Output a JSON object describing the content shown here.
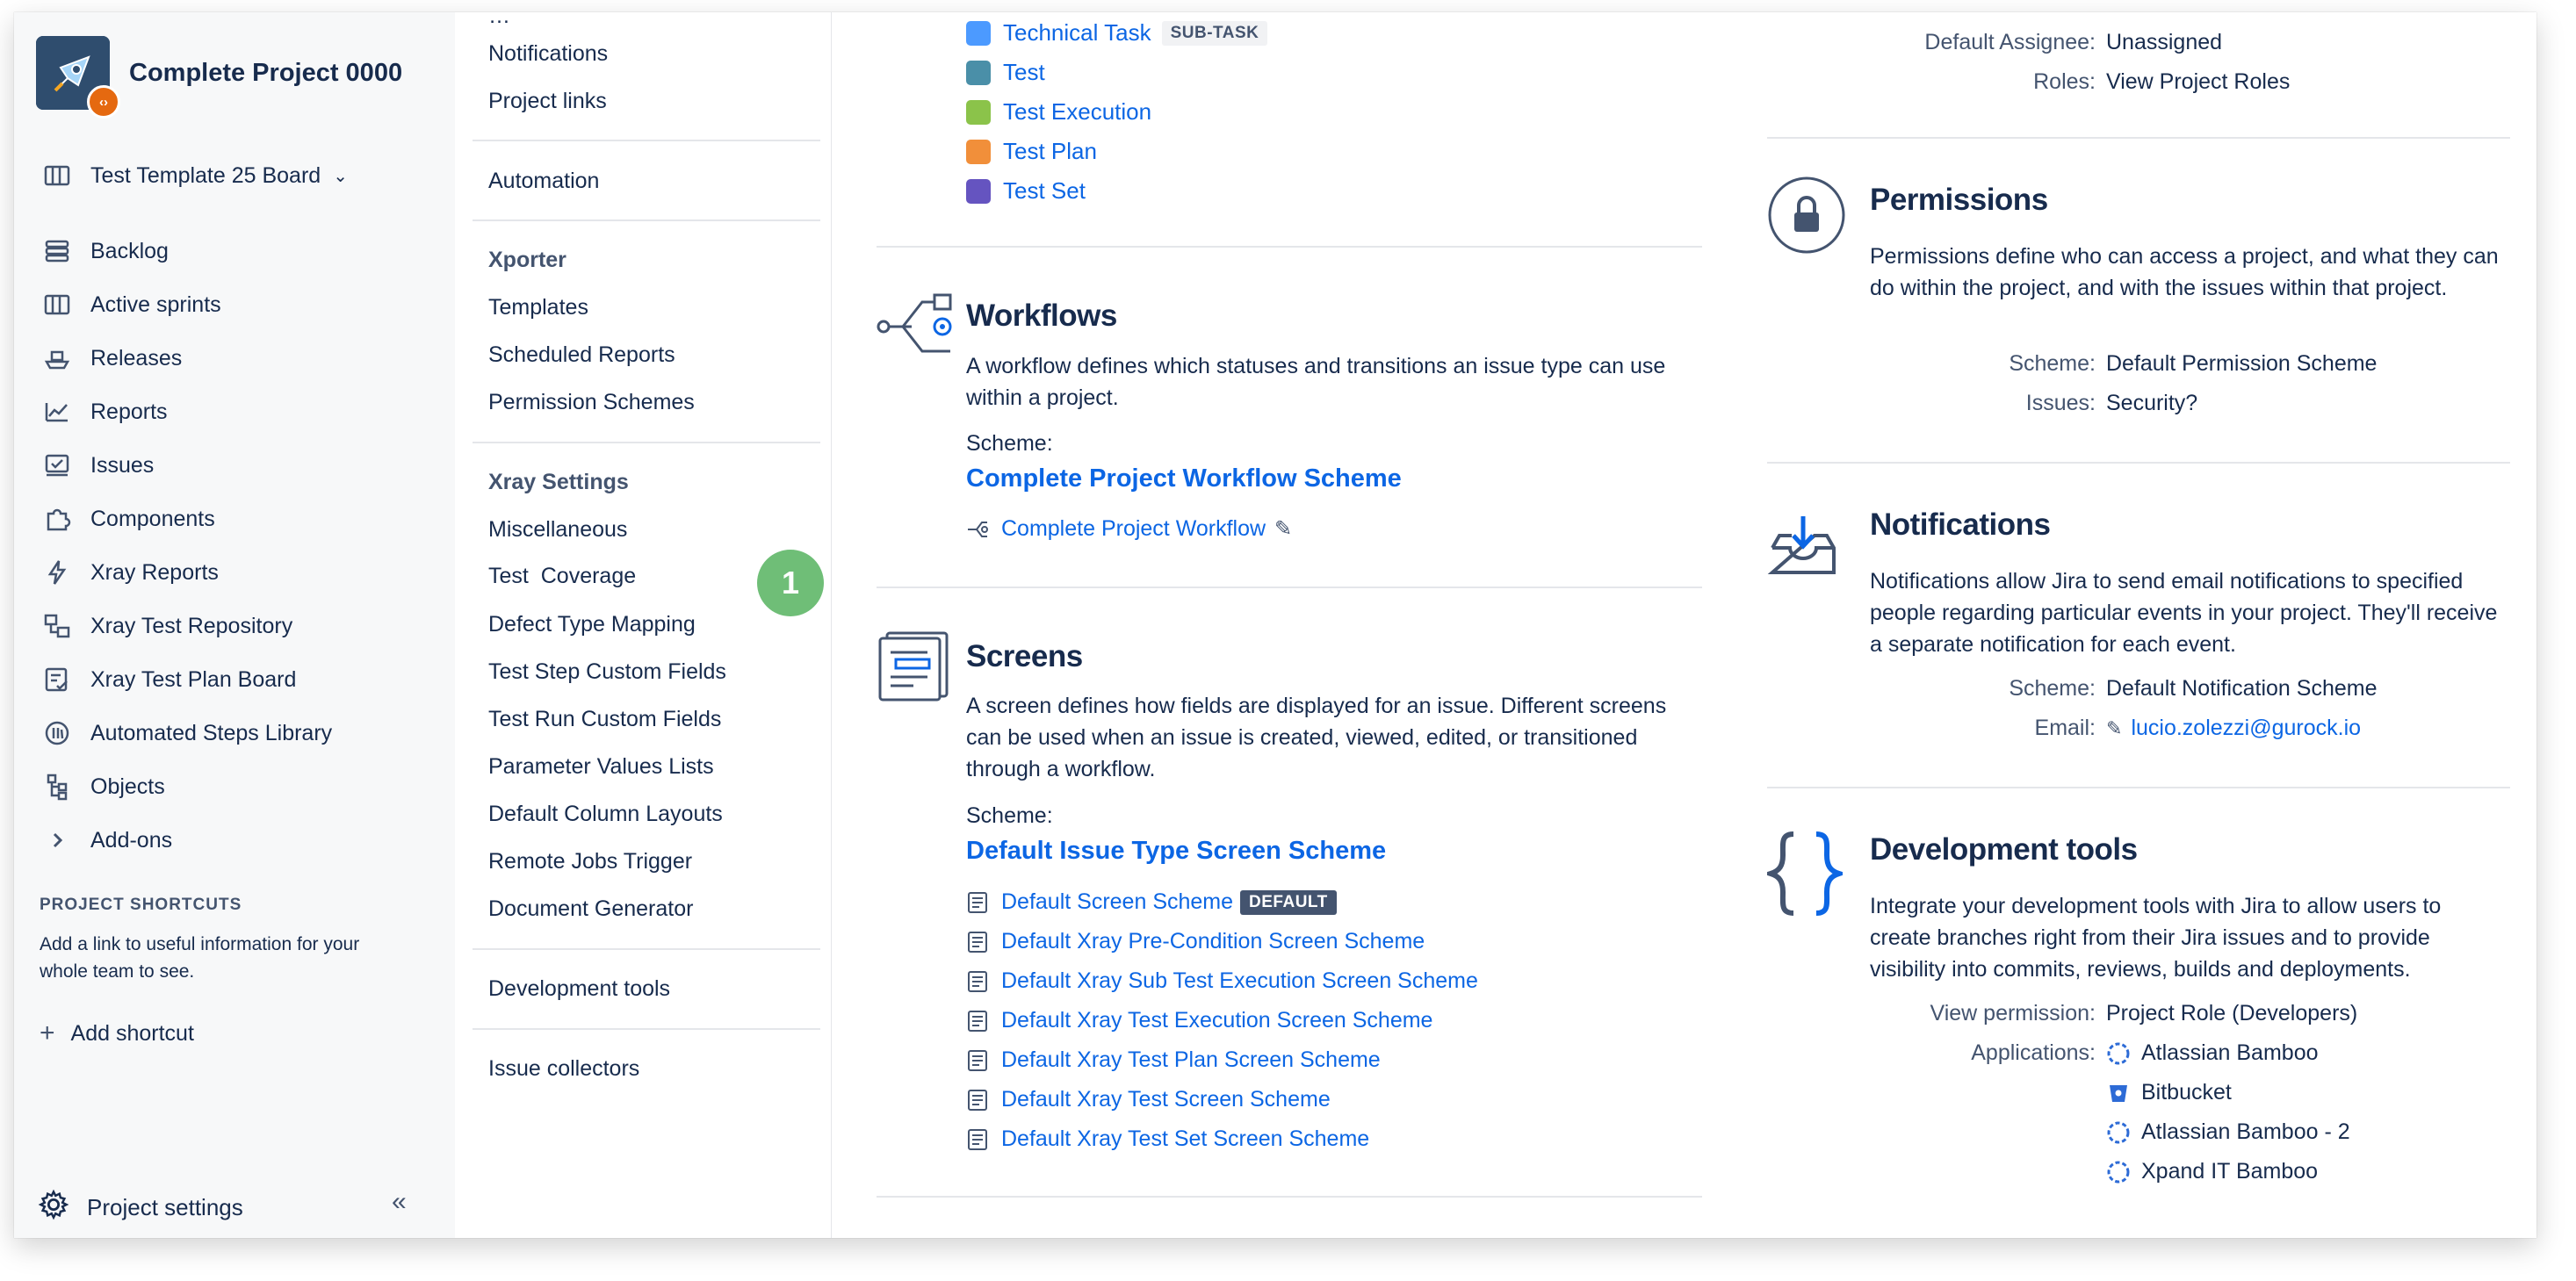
{
  "sidebar": {
    "project_name": "Complete Project 0000",
    "board_name": "Test Template 25 Board",
    "items": [
      {
        "label": "Backlog",
        "icon": "backlog-icon"
      },
      {
        "label": "Active sprints",
        "icon": "board-icon"
      },
      {
        "label": "Releases",
        "icon": "ship-icon"
      },
      {
        "label": "Reports",
        "icon": "chart-icon"
      },
      {
        "label": "Issues",
        "icon": "issues-icon"
      },
      {
        "label": "Components",
        "icon": "puzzle-icon"
      },
      {
        "label": "Xray Reports",
        "icon": "lightning-icon"
      },
      {
        "label": "Xray Test Repository",
        "icon": "repository-icon"
      },
      {
        "label": "Xray Test Plan Board",
        "icon": "test-plan-icon"
      },
      {
        "label": "Automated Steps Library",
        "icon": "library-icon"
      },
      {
        "label": "Objects",
        "icon": "objects-icon"
      },
      {
        "label": "Add-ons",
        "icon": "chevron-right-icon"
      }
    ],
    "shortcuts_heading": "PROJECT SHORTCUTS",
    "shortcuts_text": "Add a link to useful information for your whole team to see.",
    "add_shortcut": "Add shortcut",
    "settings_label": "Project settings"
  },
  "subnav": {
    "group1": [
      "Notifications",
      "Project links"
    ],
    "automation": "Automation",
    "xporter_heading": "Xporter",
    "xporter_items": [
      "Templates",
      "Scheduled Reports",
      "Permission Schemes"
    ],
    "xray_heading": "Xray Settings",
    "xray_items": [
      "Miscellaneous",
      "Test  Coverage",
      "Defect Type Mapping",
      "Test Step Custom Fields",
      "Test Run Custom Fields",
      "Parameter Values Lists",
      "Default Column Layouts",
      "Remote Jobs Trigger",
      "Document Generator"
    ],
    "dev_tools": "Development tools",
    "issue_collectors": "Issue collectors",
    "step_marker": "1"
  },
  "issue_types": [
    {
      "label": "Technical Task",
      "badge": "SUB-TASK",
      "color": "#4c9aff"
    },
    {
      "label": "Test",
      "color": "#4a8fa8"
    },
    {
      "label": "Test Execution",
      "color": "#8bc34a"
    },
    {
      "label": "Test Plan",
      "color": "#f18f3a"
    },
    {
      "label": "Test Set",
      "color": "#6554c0"
    }
  ],
  "workflows": {
    "title": "Workflows",
    "description": "A workflow defines which statuses and transitions an issue type can use within a project.",
    "scheme_label": "Scheme:",
    "scheme_name": "Complete Project Workflow Scheme",
    "workflow_link": "Complete Project Workflow"
  },
  "screens": {
    "title": "Screens",
    "description": "A screen defines how fields are displayed for an issue. Different screens can be used when an issue is created, viewed, edited, or transitioned through a workflow.",
    "scheme_label": "Scheme:",
    "scheme_name": "Default Issue Type Screen Scheme",
    "items": [
      {
        "label": "Default Screen Scheme",
        "badge": "DEFAULT"
      },
      {
        "label": "Default Xray Pre-Condition Screen Scheme"
      },
      {
        "label": "Default Xray Sub Test Execution Screen Scheme"
      },
      {
        "label": "Default Xray Test Execution Screen Scheme"
      },
      {
        "label": "Default Xray Test Plan Screen Scheme"
      },
      {
        "label": "Default Xray Test Screen Scheme"
      },
      {
        "label": "Default Xray Test Set Screen Scheme"
      }
    ]
  },
  "people": {
    "default_assignee_key": "Default Assignee:",
    "default_assignee_val": "Unassigned",
    "roles_key": "Roles:",
    "roles_val": "View Project Roles"
  },
  "permissions": {
    "title": "Permissions",
    "description": "Permissions define who can access a project, and what they can do within the project, and with the issues within that project.",
    "scheme_key": "Scheme:",
    "scheme_val": "Default Permission Scheme",
    "issues_key": "Issues:",
    "issues_val": "Security?"
  },
  "notifications": {
    "title": "Notifications",
    "description": "Notifications allow Jira to send email notifications to specified people regarding particular events in your project. They'll receive a separate notification for each event.",
    "scheme_key": "Scheme:",
    "scheme_val": "Default Notification Scheme",
    "email_key": "Email:",
    "email_val": "lucio.zolezzi@gurock.io"
  },
  "devtools": {
    "title": "Development tools",
    "description": "Integrate your development tools with Jira to allow users to create branches right from their Jira issues and to provide visibility into commits, reviews, builds and deployments.",
    "view_perm_key": "View permission:",
    "view_perm_val": "Project Role (Developers)",
    "apps_key": "Applications:",
    "apps": [
      "Atlassian Bamboo",
      "Bitbucket",
      "Atlassian Bamboo - 2",
      "Xpand IT Bamboo"
    ]
  },
  "colors": {
    "link": "#0c66e4",
    "text": "#172b4d",
    "muted": "#44546f",
    "step_badge": "#6fbe77"
  }
}
